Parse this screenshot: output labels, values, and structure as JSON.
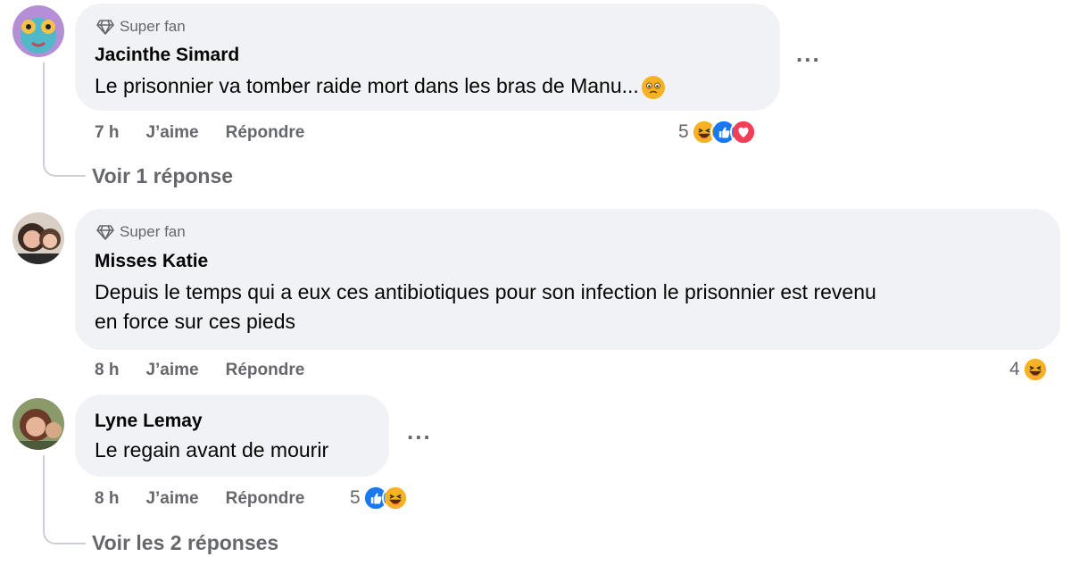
{
  "comments": [
    {
      "badge": "Super fan",
      "author": "Jacinthe Simard",
      "text": "Le prisonnier va tomber raide mort dans les bras de Manu...",
      "time": "7 h",
      "like": "J’aime",
      "reply": "Répondre",
      "reaction_count": "5",
      "see_replies": "Voir 1 réponse"
    },
    {
      "badge": "Super fan",
      "author": "Misses Katie",
      "text_line1": "Depuis le temps qui a eux ces antibiotiques pour son infection le prisonnier est revenu",
      "text_line2": "en force sur ces pieds",
      "time": "8 h",
      "like": "J’aime",
      "reply": "Répondre",
      "reaction_count": "4"
    },
    {
      "author": "Lyne Lemay",
      "text": "Le regain avant de mourir",
      "time": "8 h",
      "like": "J’aime",
      "reply": "Répondre",
      "reaction_count": "5",
      "see_replies": "Voir les 2 réponses"
    }
  ],
  "more_label": "...",
  "colors": {
    "bubble": "#f0f2f5",
    "meta": "#65676b",
    "like_blue": "#1877f2",
    "love_red": "#f33e58",
    "haha_yellow": "#f7b125"
  }
}
